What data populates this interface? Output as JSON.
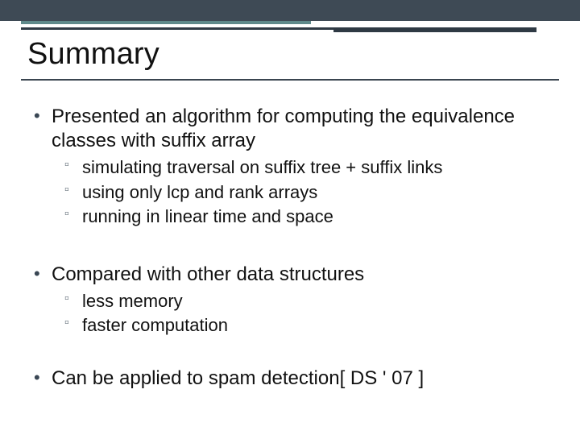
{
  "title": "Summary",
  "bullets": [
    {
      "text": "Presented an algorithm for computing the equivalence classes with suffix array",
      "sub": [
        "simulating traversal on suffix tree + suffix links",
        "using only lcp and rank arrays",
        "running in linear time and space"
      ]
    },
    {
      "text": "Compared with other data structures",
      "sub": [
        "less memory",
        "faster computation"
      ]
    },
    {
      "text": "Can be applied to spam detection[ DS ' 07 ]",
      "sub": []
    }
  ],
  "colors": {
    "topbar": "#3e4a55",
    "teal_rule": "#5f8a8b",
    "dark_rule": "#2f3a44"
  }
}
